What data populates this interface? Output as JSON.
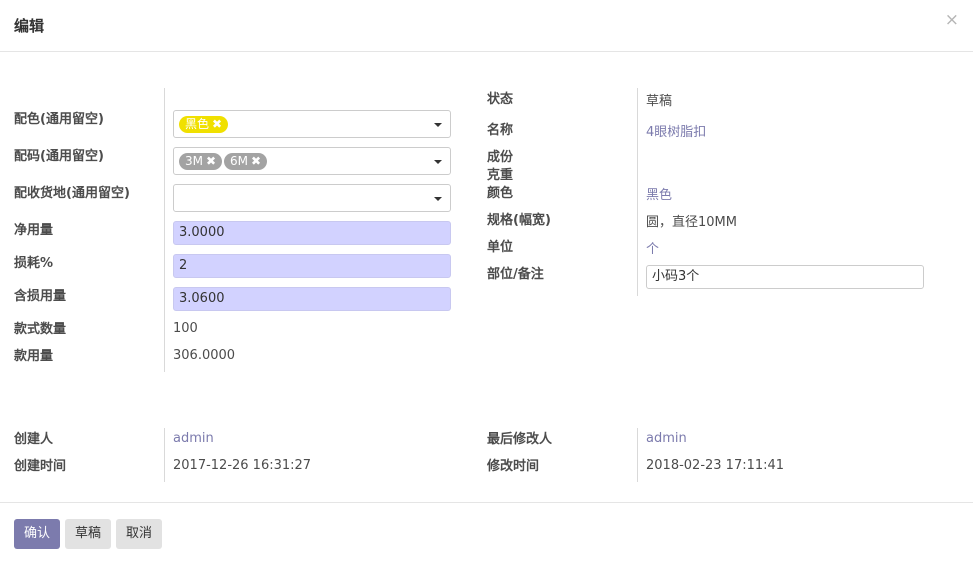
{
  "dialog": {
    "title": "编辑",
    "close": "×"
  },
  "left": {
    "color_label": "配色(通用留空)",
    "color_tags": [
      {
        "label": "黑色"
      }
    ],
    "size_label": "配码(通用留空)",
    "size_tags": [
      {
        "label": "3M"
      },
      {
        "label": "6M"
      }
    ],
    "dest_label": "配收货地(通用留空)",
    "net_label": "净用量",
    "net_value": "3.0000",
    "loss_label": "损耗%",
    "loss_value": "2",
    "gross_label": "含损用量",
    "gross_value": "3.0600",
    "style_qty_label": "款式数量",
    "style_qty_value": "100",
    "style_usage_label": "款用量",
    "style_usage_value": "306.0000"
  },
  "right": {
    "status_label": "状态",
    "status_value": "草稿",
    "name_label": "名称",
    "name_value": "4眼树脂扣",
    "composition_label": "成份",
    "weight_label": "克重",
    "color_label": "颜色",
    "color_value": "黑色",
    "spec_label": "规格(幅宽)",
    "spec_value": "圆，直径10MM",
    "unit_label": "单位",
    "unit_value": "个",
    "remark_label": "部位/备注",
    "remark_value": "小码3个"
  },
  "meta": {
    "creator_label": "创建人",
    "creator_value": "admin",
    "created_label": "创建时间",
    "created_value": "2017-12-26 16:31:27",
    "modifier_label": "最后修改人",
    "modifier_value": "admin",
    "modified_label": "修改时间",
    "modified_value": "2018-02-23 17:11:41"
  },
  "footer": {
    "confirm": "确认",
    "draft": "草稿",
    "cancel": "取消"
  },
  "icons": {
    "tag_remove": "tag-remove-icon",
    "dropdown": "dropdown-caret-icon"
  },
  "colors": {
    "primary": "#7c7bad",
    "tag_yellow": "#f0e000",
    "tag_grey": "#a3a3a3",
    "input_highlight": "#d2d2ff"
  }
}
